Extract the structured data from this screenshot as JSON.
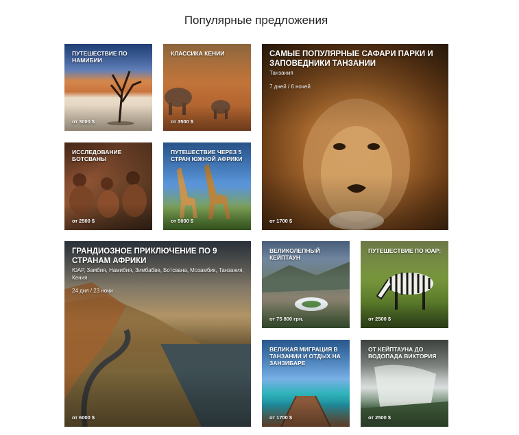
{
  "page": {
    "title": "Популярные предложения"
  },
  "cards": {
    "namibia": {
      "name": "ПУТЕШЕСТВИЕ ПО НАМИБИИ",
      "price": "от 3000 $"
    },
    "kenya": {
      "name": "КЛАССИКА КЕНИИ",
      "price": "от 3500 $"
    },
    "tanzania": {
      "name": "САМЫЕ ПОПУЛЯРНЫЕ САФАРИ ПАРКИ И ЗАПОВЕДНИКИ ТАНЗАНИИ",
      "country": "Танзания",
      "duration": "7 дней / 6 ночей",
      "price": "от 1700 $"
    },
    "botswana": {
      "name": "ИССЛЕДОВАНИЕ БОТСВАНЫ",
      "price": "от 2500 $"
    },
    "southern": {
      "name": "ПУТЕШЕСТВИЕ ЧЕРЕЗ 5 СТРАН ЮЖНОЙ АФРИКИ",
      "price": "от 5000 $"
    },
    "africa9": {
      "name": "ГРАНДИОЗНОЕ ПРИКЛЮЧЕНИЕ ПО 9 СТРАНАМ АФРИКИ",
      "countries": "ЮАР, Замбия, Намибия, Зимбабве, Ботсвана, Мозамбик, Танзания, Кения",
      "duration": "24 дня / 23 ночи",
      "price": "от 6000 $"
    },
    "capetown": {
      "name": "ВЕЛИКОЛЕПНЫЙ КЕЙПТАУН",
      "price": "от 75 800 грн."
    },
    "sa": {
      "name": "ПУТЕШЕСТВИЕ ПО ЮАР:",
      "price": "от 2500 $"
    },
    "migration": {
      "name": "ВЕЛИКАЯ МИГРАЦИЯ В ТАНЗАНИИ И ОТДЫХ НА ЗАНЗИБАРЕ",
      "price": "от 1700 $"
    },
    "victoria": {
      "name": "ОТ КЕЙПТАУНА ДО ВОДОПАДА ВИКТОРИЯ",
      "price": "от 2500 $"
    }
  }
}
